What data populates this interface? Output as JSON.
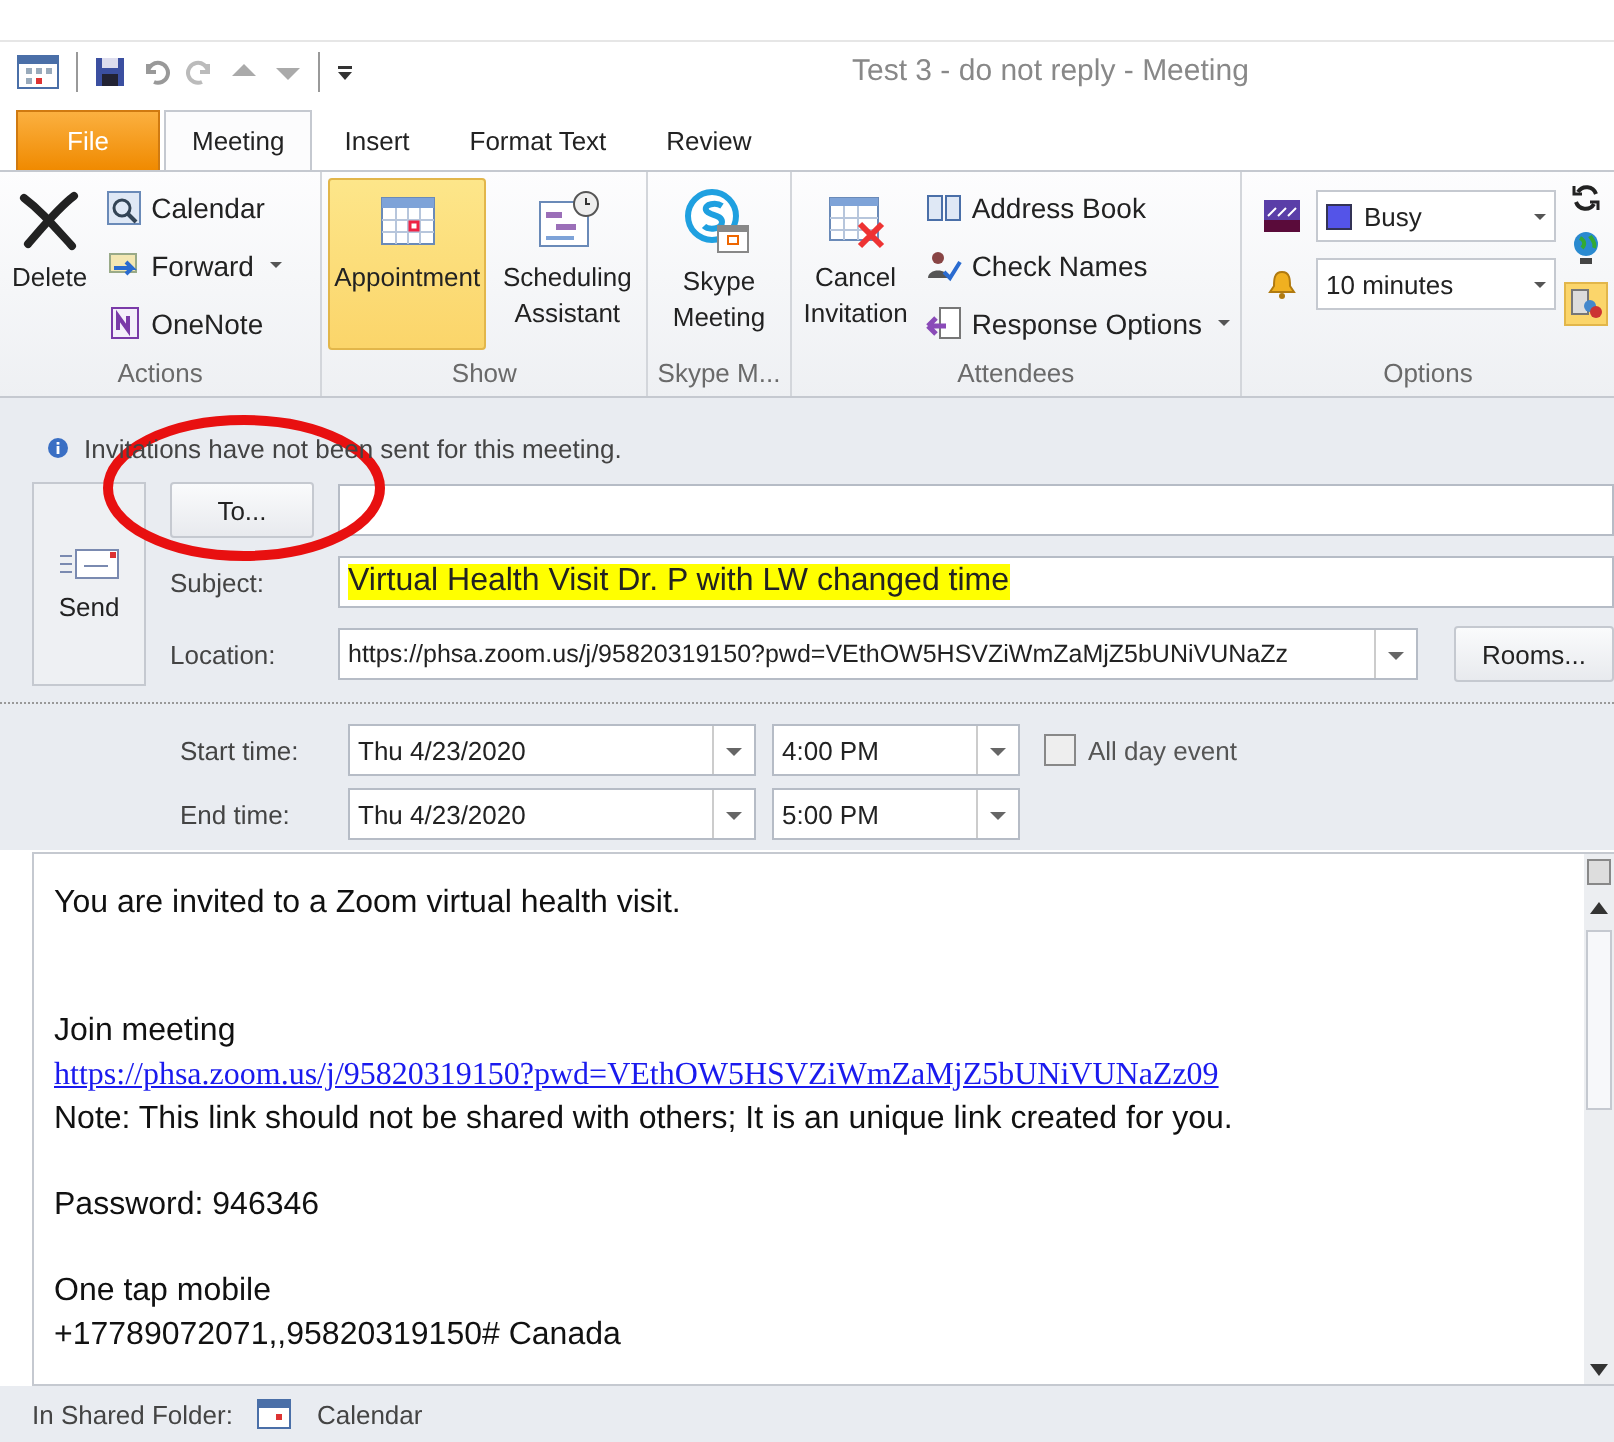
{
  "window": {
    "title": "Test 3 - do not reply - Meeting"
  },
  "tabs": [
    {
      "label": "File",
      "kind": "backstage",
      "selected": false
    },
    {
      "label": "Meeting",
      "kind": "tab",
      "selected": true
    },
    {
      "label": "Insert",
      "kind": "tab",
      "selected": false
    },
    {
      "label": "Format Text",
      "kind": "tab",
      "selected": false
    },
    {
      "label": "Review",
      "kind": "tab",
      "selected": false
    }
  ],
  "ribbon": {
    "actions": {
      "label": "Actions",
      "delete": "Delete",
      "calendar": "Calendar",
      "forward": "Forward",
      "onenote": "OneNote"
    },
    "show": {
      "label": "Show",
      "views": [
        {
          "label": "Appointment",
          "selected": true
        },
        {
          "label": "Scheduling Assistant",
          "selected": false
        }
      ]
    },
    "skype": {
      "label": "Skype M...",
      "meeting": "Skype Meeting"
    },
    "attendees": {
      "label": "Attendees",
      "cancel": "Cancel Invitation",
      "address_book": "Address Book",
      "check_names": "Check Names",
      "response_options": "Response Options"
    },
    "options": {
      "label": "Options",
      "show_as": "Busy",
      "reminder": "10 minutes",
      "room_finder_on": true
    }
  },
  "info_bar": "Invitations have not been sent for this meeting.",
  "form": {
    "send": "Send",
    "to_button": "To...",
    "subject_label": "Subject:",
    "subject": "Virtual Health Visit Dr. P with LW changed time",
    "subject_highlighted": true,
    "location_label": "Location:",
    "location": "https://phsa.zoom.us/j/95820319150?pwd=VEthOW5HSVZiWmZaMjZ5bUNiVUNaZz",
    "rooms": "Rooms...",
    "start_label": "Start time:",
    "start_date": "Thu 4/23/2020",
    "start_time": "4:00 PM",
    "all_day_label": "All day event",
    "all_day": false,
    "end_label": "End time:",
    "end_date": "Thu 4/23/2020",
    "end_time": "5:00 PM"
  },
  "body": {
    "paragraphs": [
      [
        {
          "kind": "text",
          "text": "You are invited to a Zoom virtual health visit."
        }
      ],
      [
        {
          "kind": "text",
          "text": "Join meeting"
        },
        {
          "kind": "link",
          "text": "https://phsa.zoom.us/j/95820319150?pwd=VEthOW5HSVZiWmZaMjZ5bUNiVUNaZz09"
        },
        {
          "kind": "text",
          "text": "Note: This link should not be shared with others; It is an unique link created for you."
        }
      ],
      [
        {
          "kind": "text",
          "text": "Password: 946346"
        }
      ],
      [
        {
          "kind": "text",
          "text": "One tap mobile"
        },
        {
          "kind": "text",
          "text": "+17789072071,,95820319150# Canada"
        }
      ]
    ]
  },
  "status_bar": {
    "label": "In Shared Folder:",
    "folder": "Calendar"
  }
}
